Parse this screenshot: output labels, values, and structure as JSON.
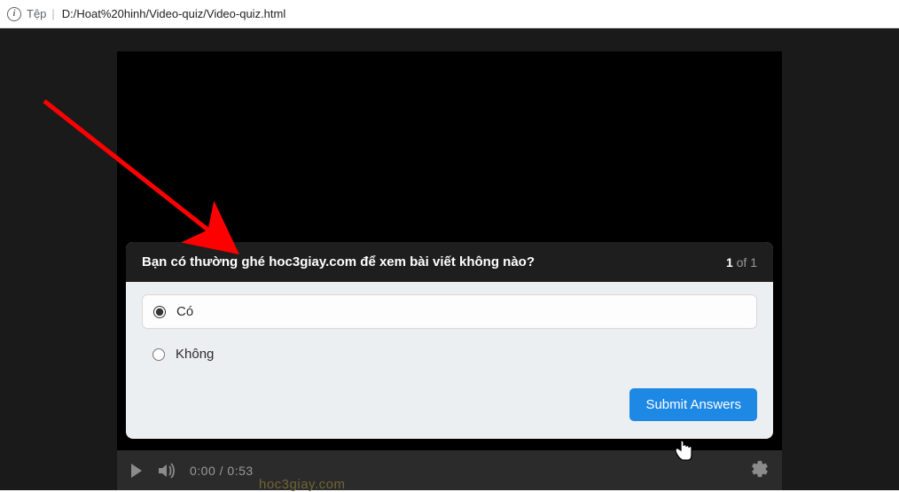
{
  "address": {
    "file_label": "Tệp",
    "url": "D:/Hoat%20hinh/Video-quiz/Video-quiz.html"
  },
  "quiz": {
    "question": "Bạn có thường ghé hoc3giay.com để xem bài viết không nào?",
    "counter_num": "1",
    "counter_of": " of 1",
    "options": [
      {
        "label": "Có",
        "selected": true
      },
      {
        "label": "Không",
        "selected": false
      }
    ],
    "submit_label": "Submit Answers"
  },
  "player": {
    "time": "0:00 / 0:53",
    "watermark": "hoc3giay.com"
  }
}
